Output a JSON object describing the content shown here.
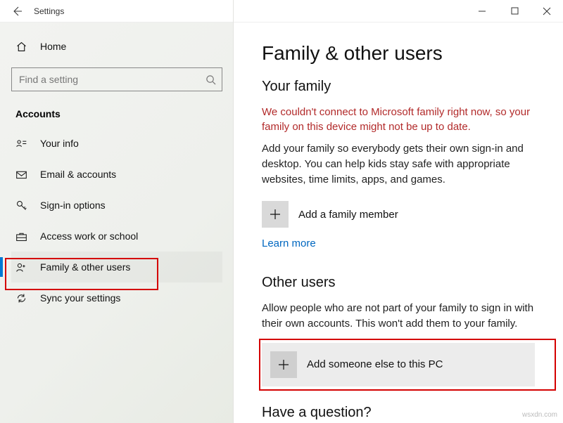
{
  "app": {
    "title": "Settings"
  },
  "sidebar": {
    "home": "Home",
    "search_placeholder": "Find a setting",
    "category": "Accounts",
    "items": [
      {
        "label": "Your info"
      },
      {
        "label": "Email & accounts"
      },
      {
        "label": "Sign-in options"
      },
      {
        "label": "Access work or school"
      },
      {
        "label": "Family & other users"
      },
      {
        "label": "Sync your settings"
      }
    ]
  },
  "main": {
    "title": "Family & other users",
    "family_heading": "Your family",
    "family_error": "We couldn't connect to Microsoft family right now, so your family on this device might not be up to date.",
    "family_para": "Add your family so everybody gets their own sign-in and desktop. You can help kids stay safe with appropriate websites, time limits, apps, and games.",
    "add_family_label": "Add a family member",
    "learn_more": "Learn more",
    "other_heading": "Other users",
    "other_para": "Allow people who are not part of your family to sign in with their own accounts. This won't add them to your family.",
    "add_other_label": "Add someone else to this PC",
    "question_heading": "Have a question?"
  },
  "watermark": "wsxdn.com"
}
